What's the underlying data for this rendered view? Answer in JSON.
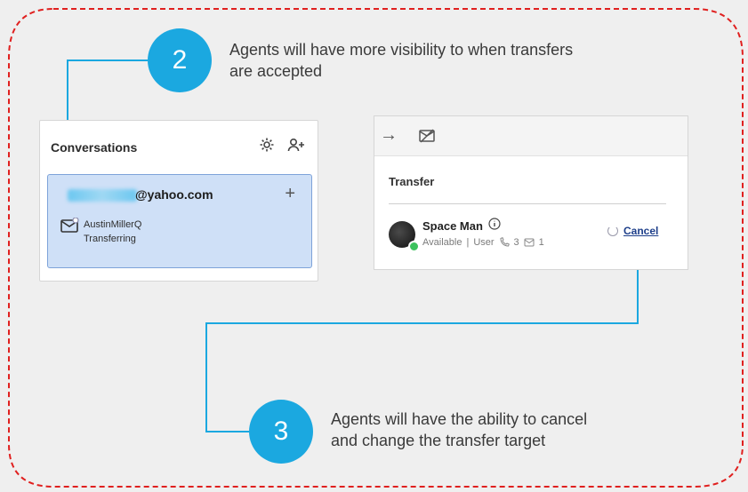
{
  "callouts": [
    {
      "number": "2",
      "text_line1": "Agents will have more visibility to when transfers",
      "text_line2": "are accepted"
    },
    {
      "number": "3",
      "text_line1": "Agents will have the ability to cancel",
      "text_line2": "and change the transfer target"
    }
  ],
  "conversations": {
    "title": "Conversations",
    "email": "@yahoo.com",
    "agent_name": "AustinMillerQ",
    "status": "Transferring",
    "icons": [
      "gear-icon",
      "add-user-icon",
      "plus-icon",
      "envelope-icon"
    ]
  },
  "transfer": {
    "title": "Transfer",
    "agent_name": "Space Man",
    "availability": "Available",
    "type": "User",
    "calls": "3",
    "messages": "1",
    "cancel_label": "Cancel",
    "icons": [
      "arrow-right-icon",
      "no-email-icon",
      "info-icon",
      "phone-icon",
      "message-icon"
    ]
  },
  "colors": {
    "accent": "#1ba8e0",
    "border_dashed": "#e0201f",
    "card_bg": "#cfe0f7",
    "status_green": "#3cc25d"
  }
}
